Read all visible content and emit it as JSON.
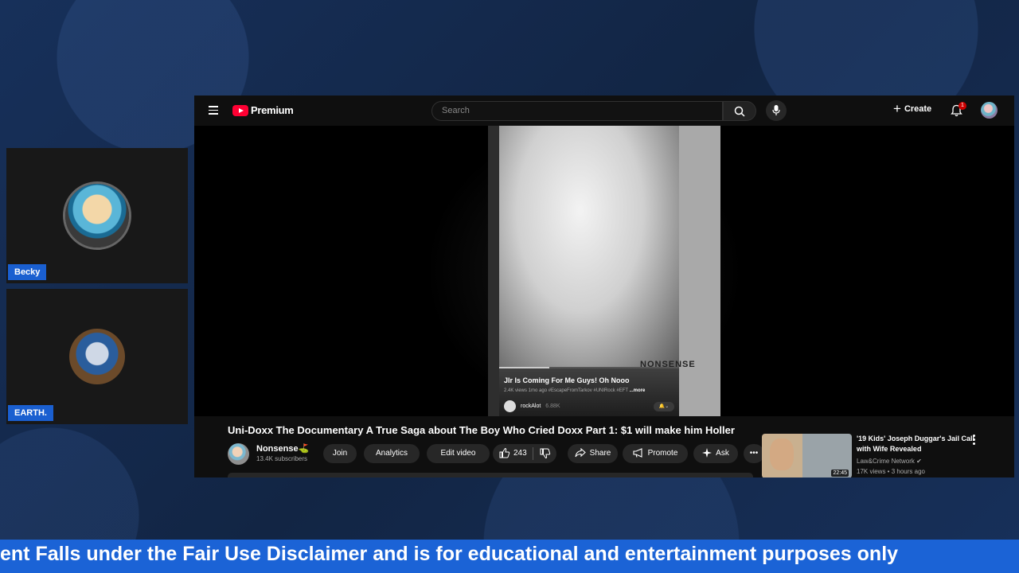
{
  "participants": [
    {
      "name": "Becky"
    },
    {
      "name": "EARTH."
    }
  ],
  "youtube": {
    "logo_text": "Premium",
    "search": {
      "placeholder": "Search"
    },
    "create_label": "Create",
    "notification_count": "1",
    "short": {
      "watermark": "NONSENSE",
      "title": "Jlr Is Coming For Me Guys! Oh Nooo",
      "meta": "2.4K views  1mo ago  #EscapeFromTarkov #UNIRock #EFT",
      "more": "...more",
      "channel": "rockAlot",
      "subs": "6.88K",
      "progress": 0.28
    },
    "video": {
      "title": "Uni-Doxx The Documentary A True Saga about The Boy Who Cried Doxx Part 1: $1 will make him Holler",
      "channel_name": "Nonsense⛳",
      "subscribers": "13.4K subscribers",
      "join": "Join",
      "analytics": "Analytics",
      "edit_video": "Edit video",
      "likes": "243",
      "share": "Share",
      "promote": "Promote",
      "ask": "Ask"
    },
    "recommended": {
      "title": "'19 Kids' Joseph Duggar's Jail Call with Wife Revealed",
      "channel": "Law&Crime Network ✔",
      "meta": "17K views • 3 hours ago",
      "duration": "22:45"
    }
  },
  "ticker": {
    "text": "ent Falls under the Fair Use Disclaimer and is for educational and entertainment purposes only"
  },
  "colors": {
    "background": "#14284a",
    "ticker": "#1b63d6",
    "name_tag": "#1a5fd0",
    "youtube_red": "#ff0033"
  }
}
